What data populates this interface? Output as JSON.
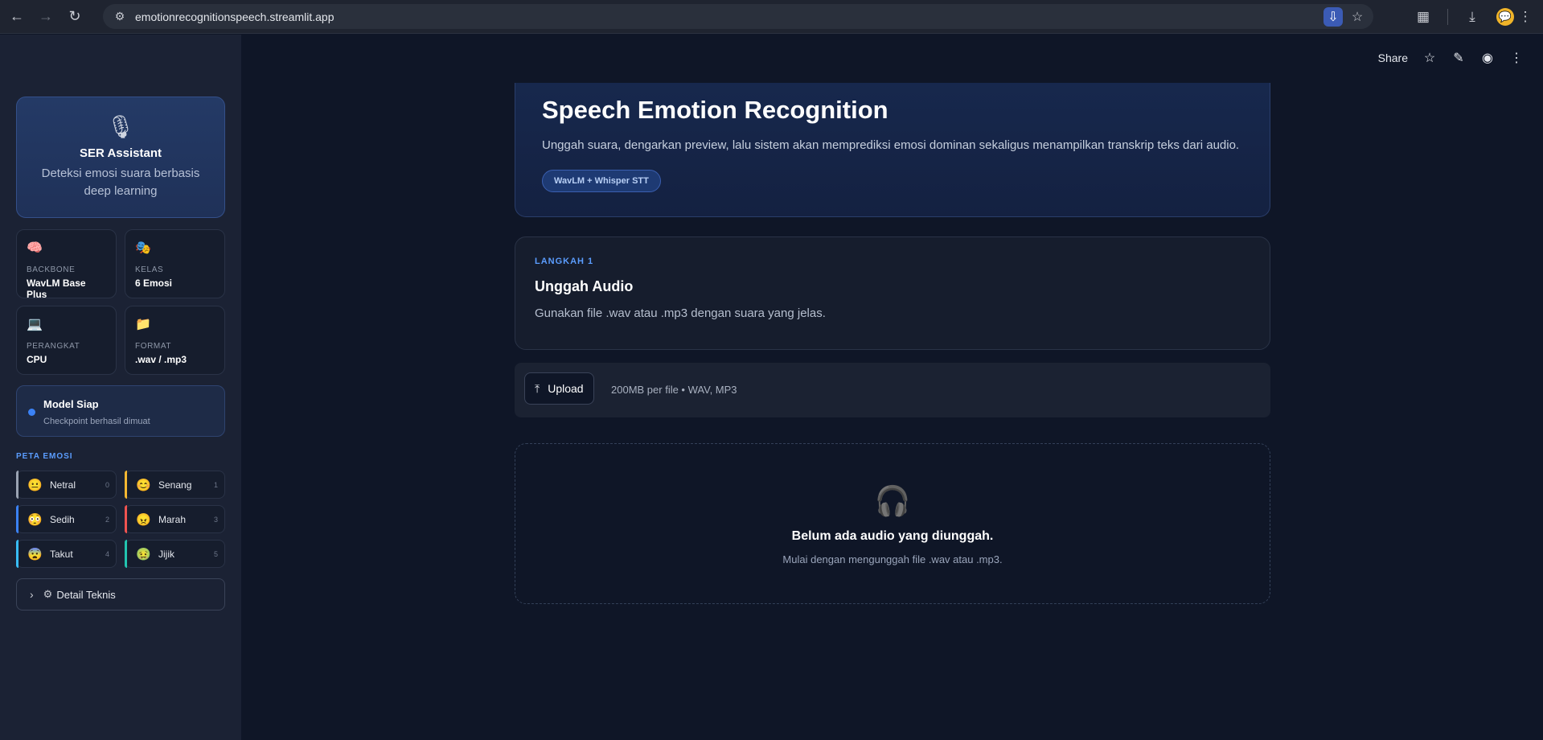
{
  "browser": {
    "url": "emotionrecognitionspeech.streamlit.app",
    "back_icon": "back-arrow-icon",
    "forward_icon": "forward-arrow-icon",
    "reload_icon": "reload-icon"
  },
  "toolbar": {
    "share_label": "Share"
  },
  "sidebar": {
    "assistant": {
      "title": "SER Assistant",
      "description": "Deteksi emosi suara berbasis deep learning"
    },
    "info_cards": [
      {
        "emoji": "🧠",
        "label": "BACKBONE",
        "value": "WavLM Base Plus"
      },
      {
        "emoji": "🎭",
        "label": "KELAS",
        "value": "6 Emosi"
      },
      {
        "emoji": "💻",
        "label": "PERANGKAT",
        "value": "CPU"
      },
      {
        "emoji": "📁",
        "label": "FORMAT",
        "value": ".wav / .mp3"
      }
    ],
    "model_status": {
      "title": "Model Siap",
      "subtitle": "Checkpoint berhasil dimuat"
    },
    "emotion_map_label": "PETA EMOSI",
    "emotions": [
      {
        "emoji": "😐",
        "name": "Netral",
        "index": "0",
        "color": "#9aa3b2"
      },
      {
        "emoji": "😊",
        "name": "Senang",
        "index": "1",
        "color": "#f5b731"
      },
      {
        "emoji": "😳",
        "name": "Sedih",
        "index": "2",
        "color": "#3b82f6"
      },
      {
        "emoji": "😠",
        "name": "Marah",
        "index": "3",
        "color": "#ef5350"
      },
      {
        "emoji": "😨",
        "name": "Takut",
        "index": "4",
        "color": "#38bdf8"
      },
      {
        "emoji": "🤢",
        "name": "Jijik",
        "index": "5",
        "color": "#22c4b0"
      }
    ],
    "detail_label": "Detail Teknis"
  },
  "hero": {
    "title": "Speech Emotion Recognition",
    "description": "Unggah suara, dengarkan preview, lalu sistem akan memprediksi emosi dominan sekaligus menampilkan transkrip teks dari audio.",
    "badge": "WavLM + Whisper STT"
  },
  "step": {
    "kicker": "LANGKAH 1",
    "title": "Unggah Audio",
    "description": "Gunakan file .wav atau .mp3 dengan suara yang jelas."
  },
  "uploader": {
    "button_label": "Upload",
    "hint": "200MB per file • WAV, MP3"
  },
  "empty_state": {
    "title": "Belum ada audio yang diunggah.",
    "subtitle": "Mulai dengan mengunggah file .wav atau .mp3."
  },
  "colors": {
    "accent": "#5b9dff",
    "status_dot": "#3b82f6"
  }
}
